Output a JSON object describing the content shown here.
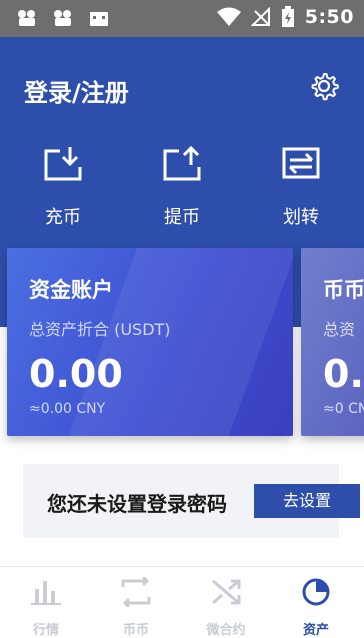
{
  "status_bar": {
    "time": "5:50"
  },
  "header": {
    "title": "登录/注册"
  },
  "actions": [
    {
      "label": "充币"
    },
    {
      "label": "提币"
    },
    {
      "label": "划转"
    }
  ],
  "cards": [
    {
      "title": "资金账户",
      "subtitle": "总资产折合 (USDT)",
      "value": "0.00",
      "cny": "≈0.00 CNY"
    },
    {
      "title": "币币",
      "subtitle": "总资",
      "value": "0.",
      "cny": "≈0 CN"
    }
  ],
  "notice": {
    "text": "您还未设置登录密码",
    "button": "去设置"
  },
  "tabs": [
    {
      "label": "行情"
    },
    {
      "label": "币币"
    },
    {
      "label": "微合约"
    },
    {
      "label": "资产"
    }
  ],
  "colors": {
    "brand": "#2d4fab",
    "inactive_tab": "#c9ccd3"
  }
}
